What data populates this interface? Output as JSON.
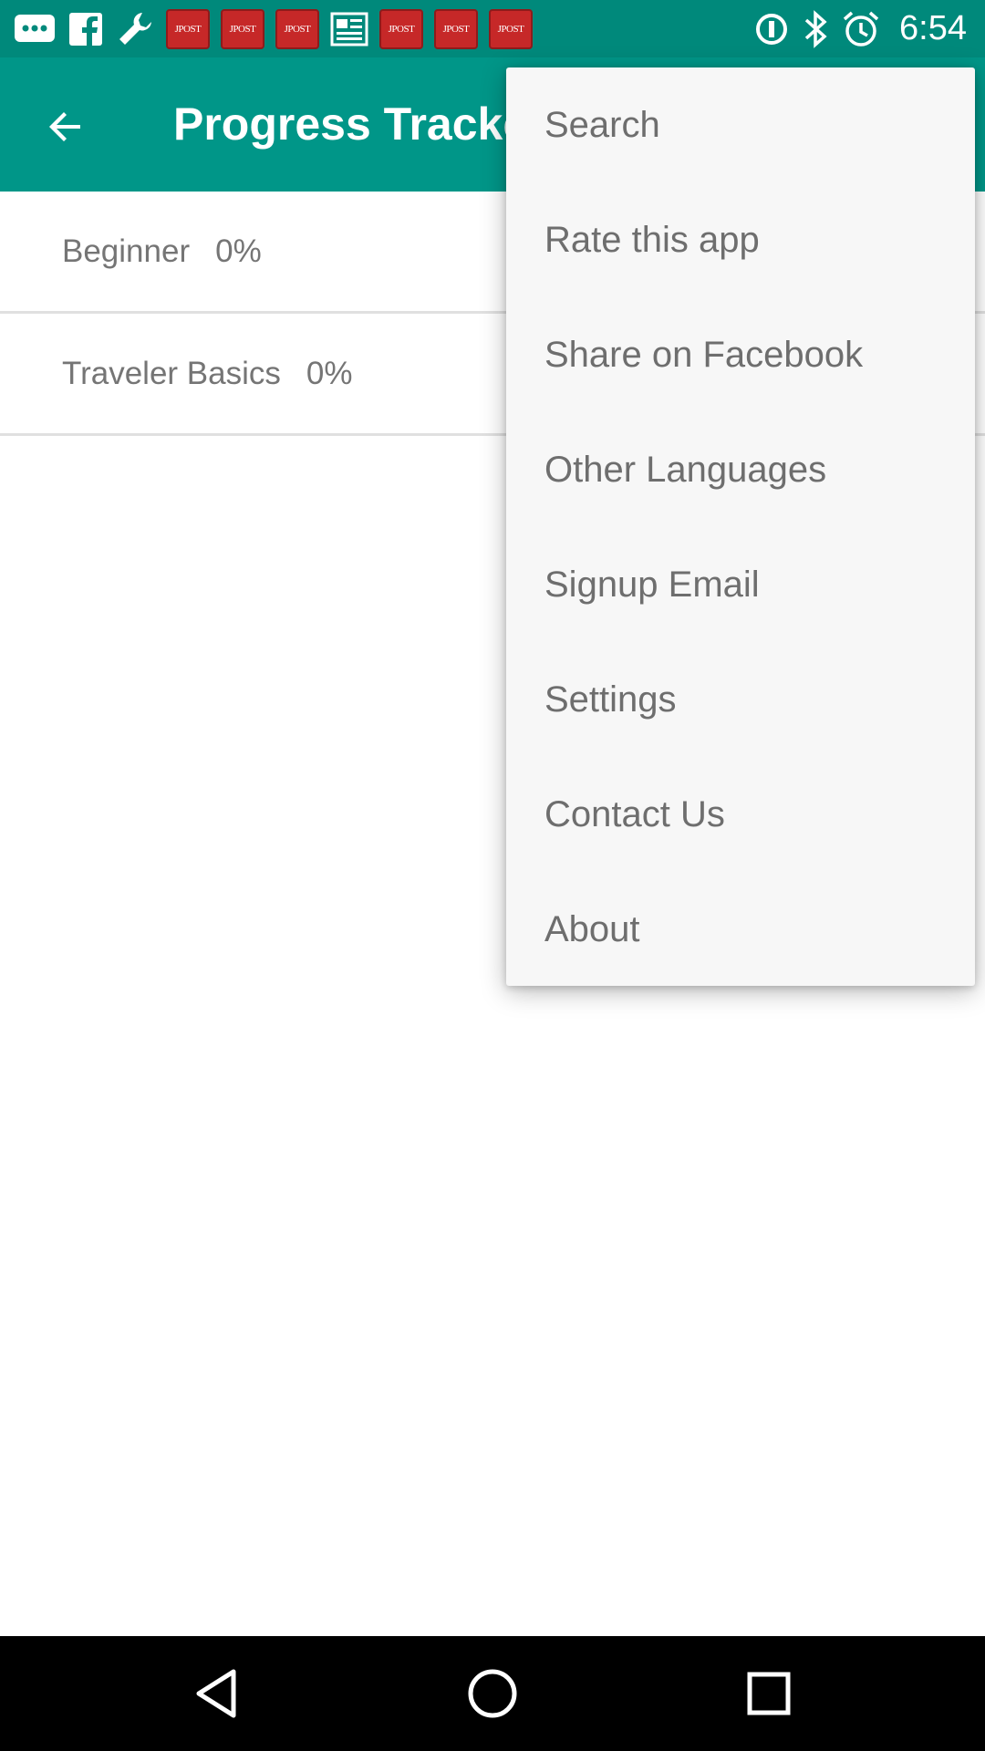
{
  "status_bar": {
    "time": "6:54",
    "notification_badges": [
      "JPOST",
      "JPOST",
      "JPOST",
      "JPOST",
      "JPOST",
      "JPOST"
    ],
    "icons": [
      "chat-icon",
      "facebook-icon",
      "wrench-icon",
      "newspaper-icon",
      "data-saver-icon",
      "bluetooth-icon",
      "alarm-icon"
    ]
  },
  "app_bar": {
    "title": "Progress Tracker",
    "back_icon": "arrow-back-icon",
    "color": "#009688"
  },
  "list": {
    "items": [
      {
        "label": "Beginner",
        "percent": "0%"
      },
      {
        "label": "Traveler Basics",
        "percent": "0%"
      }
    ]
  },
  "menu": {
    "items": [
      {
        "label": "Search"
      },
      {
        "label": "Rate this app"
      },
      {
        "label": "Share on Facebook"
      },
      {
        "label": "Other Languages"
      },
      {
        "label": "Signup Email"
      },
      {
        "label": "Settings"
      },
      {
        "label": "Contact Us"
      },
      {
        "label": "About"
      }
    ]
  },
  "nav_bar": {
    "icons": [
      "back-triangle-icon",
      "home-circle-icon",
      "recents-square-icon"
    ]
  }
}
